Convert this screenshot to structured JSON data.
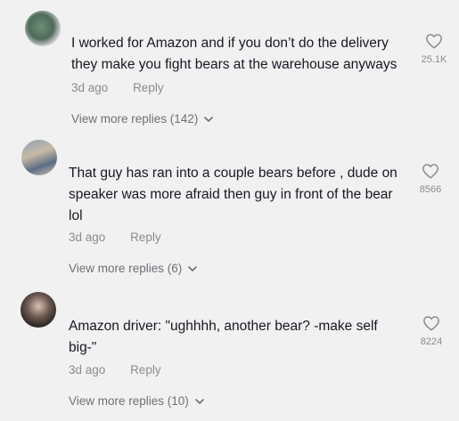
{
  "comments": [
    {
      "text_line1": "I worked for Amazon and if you don’t do the delivery",
      "text_line2": "they make you fight bears at the warehouse anyways",
      "text_line3": "",
      "time": "3d ago",
      "reply_label": "Reply",
      "view_more": "View more replies (142)",
      "likes": "25.1K"
    },
    {
      "text_line1": "That guy has ran into a couple bears before , dude on",
      "text_line2": "speaker was more afraid then guy in front of the bear",
      "text_line3": "lol",
      "time": "3d ago",
      "reply_label": "Reply",
      "view_more": "View more replies (6)",
      "likes": "8566"
    },
    {
      "text_line1": "Amazon driver: \"ughhhh, another bear? -make self",
      "text_line2": "big-\"",
      "text_line3": "",
      "time": "3d ago",
      "reply_label": "Reply",
      "view_more": "View more replies (10)",
      "likes": "8224"
    }
  ],
  "icons": {
    "heart": "heart-icon",
    "chevron": "chevron-down-icon"
  },
  "colors": {
    "background": "#f1f1f1",
    "text": "#161823",
    "meta": "#8a8b91"
  }
}
